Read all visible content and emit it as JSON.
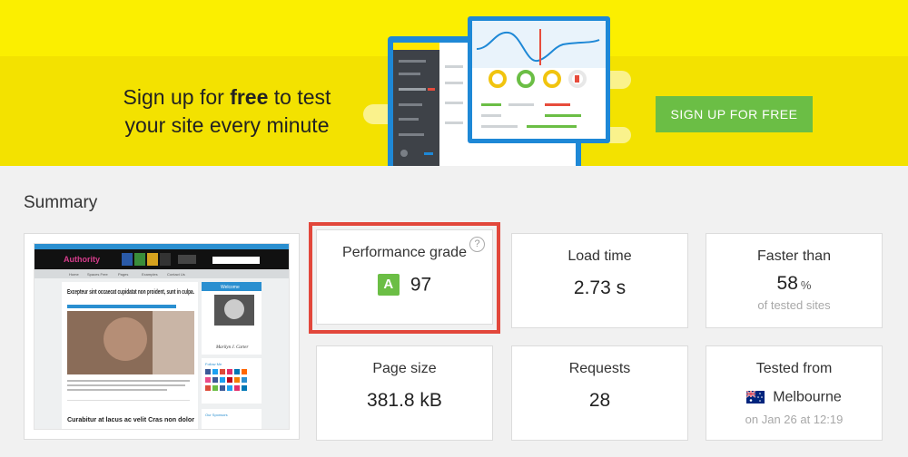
{
  "banner": {
    "text_pre": "Sign up for ",
    "text_bold": "free",
    "text_post": " to test",
    "text_line2": "your site every minute",
    "cta_label": "SIGN UP FOR FREE"
  },
  "summary": {
    "title": "Summary",
    "performance": {
      "label": "Performance grade",
      "grade": "A",
      "score": "97",
      "help": "?"
    },
    "load_time": {
      "label": "Load time",
      "value": "2.73 s"
    },
    "faster_than": {
      "label": "Faster than",
      "value": "58",
      "unit": "%",
      "sub": "of tested sites"
    },
    "page_size": {
      "label": "Page size",
      "value": "381.8 kB"
    },
    "requests": {
      "label": "Requests",
      "value": "28"
    },
    "tested_from": {
      "label": "Tested from",
      "location": "Melbourne",
      "date": "on Jan 26 at 12:19"
    }
  },
  "thumbnail": {
    "site_name": "Authority",
    "nav": [
      "Home",
      "Spaces Free",
      "Pages",
      "Examples",
      "Contact Us"
    ],
    "post_title": "Excepteur sint occaecat cupidatat non proident, sunt in culpa.",
    "post2_title": "Curabitur at lacus ac velit Cras non dolor",
    "widget_title": "Welcome",
    "signature": "Marilyn J. Carter",
    "follow_title": "Follow Me",
    "sponsors_title": "Our Sponsors"
  },
  "colors": {
    "banner": "#fbef00",
    "cta": "#6bbe45",
    "grade": "#6bbe45",
    "highlight": "#e2473b"
  }
}
